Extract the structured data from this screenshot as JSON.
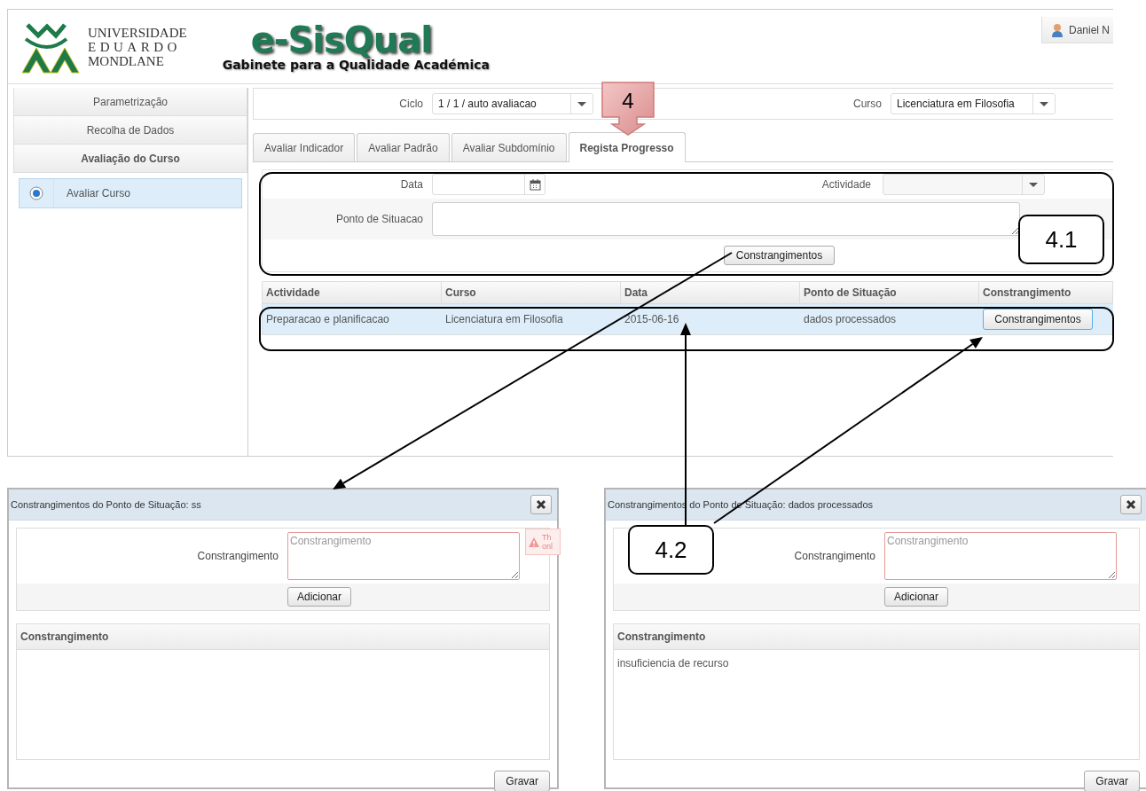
{
  "header": {
    "university_lines": [
      "UNIVERSIDADE",
      "EDUARDO",
      "MONDLANE"
    ],
    "app_title": "e-SisQual",
    "app_subtitle": "Gabinete para a Qualidade Académica",
    "user": "Daniel N"
  },
  "sidebar": {
    "sections": [
      {
        "label": "Parametrização",
        "selected": false
      },
      {
        "label": "Recolha de Dados",
        "selected": false
      },
      {
        "label": "Avaliação do Curso",
        "selected": true
      }
    ],
    "items": [
      {
        "label": "Avaliar Curso",
        "selected": true
      }
    ]
  },
  "filters": [
    {
      "label": "Ciclo",
      "value": "1 / 1 / auto avaliacao"
    },
    {
      "label": "Curso",
      "value": "Licenciatura em Filosofia"
    }
  ],
  "tabs": [
    {
      "label": "Avaliar Indicador",
      "selected": false
    },
    {
      "label": "Avaliar Padrão",
      "selected": false
    },
    {
      "label": "Avaliar Subdomínio",
      "selected": false
    },
    {
      "label": "Regista Progresso",
      "selected": true
    }
  ],
  "form": {
    "date_label": "Data",
    "activity_label": "Actividade",
    "status_label": "Ponto de Situacao",
    "button": "Constrangimentos"
  },
  "table": {
    "columns": [
      "Actividade",
      "Curso",
      "Data",
      "Ponto de Situação",
      "Constrangimento"
    ],
    "rows": [
      {
        "cells": [
          "Preparacao e planificacao",
          "Licenciatura em Filosofia",
          "2015-06-16",
          "dados processados"
        ],
        "button": "Constrangimentos",
        "selected": true
      }
    ]
  },
  "dialogs": [
    {
      "title": "Constrangimentos do Ponto de Situação: ss",
      "field_label": "Constrangimento",
      "placeholder": "Constrangimento",
      "add_button": "Adicionar",
      "column": "Constrangimento",
      "save_button": "Gravar",
      "tooltip": [
        "Th",
        "onl"
      ]
    },
    {
      "title": "Constrangimentos do Ponto de Situação: dados processados",
      "field_label": "Constrangimento",
      "placeholder": "Constrangimento",
      "add_button": "Adicionar",
      "column": "Constrangimento",
      "rows": [
        "insuficiencia de recurso"
      ],
      "save_button": "Gravar"
    }
  ],
  "annotations": [
    {
      "label": "4",
      "kind": "arrow-box"
    },
    {
      "label": "4.1",
      "kind": "box"
    },
    {
      "label": "4.2",
      "kind": "box"
    }
  ]
}
